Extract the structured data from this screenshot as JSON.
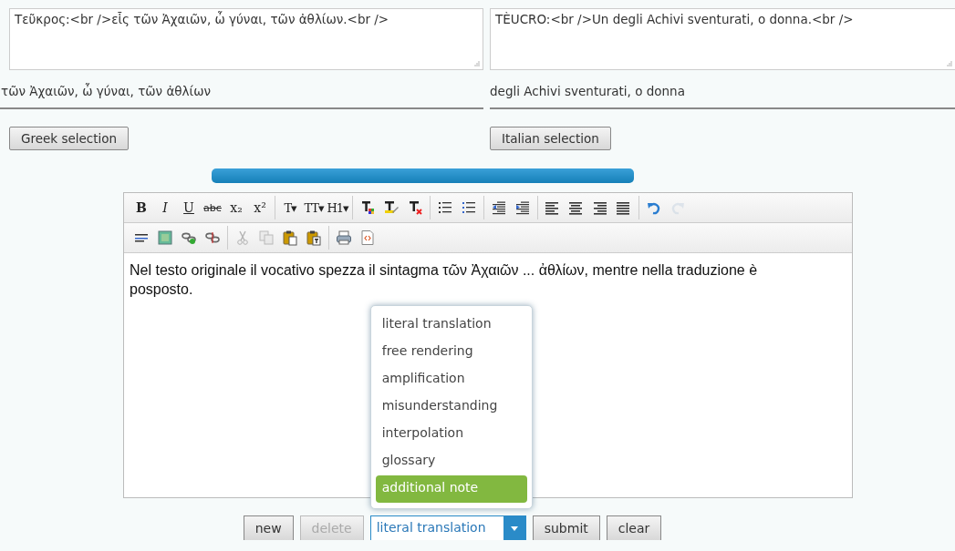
{
  "source_panel": {
    "text": "Τεῦκρος:<br />εἷς τῶν Ἀχαιῶν, ὦ γύναι, τῶν ἀθλίων.<br />",
    "selection": "τῶν Ἀχαιῶν, ὦ γύναι, τῶν ἀθλίων",
    "button": "Greek selection"
  },
  "target_panel": {
    "text": "TÈUCRO:<br />Un degli Achivi sventurati, o donna.<br />",
    "selection": "degli Achivi sventurati, o donna",
    "button": "Italian selection"
  },
  "progress": {
    "level": 1
  },
  "editor": {
    "toolbar_rows": [
      [
        [
          {
            "kind": "bold",
            "glyph": "B"
          },
          {
            "kind": "italic",
            "glyph": "I"
          },
          {
            "kind": "underline",
            "glyph": "U"
          },
          {
            "kind": "strike",
            "glyph": "abc"
          },
          {
            "kind": "sub",
            "glyph": "x₂"
          },
          {
            "kind": "sup",
            "glyph": "x²"
          }
        ],
        [
          {
            "kind": "font",
            "glyph": "T▾"
          },
          {
            "kind": "size",
            "glyph": "TT▾"
          },
          {
            "kind": "format",
            "glyph": "H1▾"
          }
        ],
        [
          {
            "kind": "text-color"
          },
          {
            "kind": "bg-color"
          },
          {
            "kind": "remove-format"
          }
        ],
        [
          {
            "kind": "bullet-list"
          },
          {
            "kind": "numbered-list"
          }
        ],
        [
          {
            "kind": "outdent"
          },
          {
            "kind": "indent"
          }
        ],
        [
          {
            "kind": "align-left"
          },
          {
            "kind": "align-center"
          },
          {
            "kind": "align-right"
          },
          {
            "kind": "justify"
          }
        ],
        [
          {
            "kind": "undo",
            "disabled": false
          },
          {
            "kind": "redo",
            "disabled": true
          }
        ]
      ],
      [
        [
          {
            "kind": "hr"
          },
          {
            "kind": "image"
          },
          {
            "kind": "link"
          },
          {
            "kind": "unlink"
          }
        ],
        [
          {
            "kind": "cut",
            "disabled": true
          },
          {
            "kind": "copy",
            "disabled": true
          },
          {
            "kind": "paste",
            "disabled": false
          },
          {
            "kind": "paste-text",
            "disabled": false
          }
        ],
        [
          {
            "kind": "print"
          },
          {
            "kind": "source"
          }
        ]
      ]
    ],
    "content": "Nel testo originale il vocativo spezza il sintagma τῶν Ἀχαιῶν ... ἀθλίων, mentre nella traduzione è posposto."
  },
  "dropdown": {
    "options": [
      {
        "label": "literal translation",
        "highlighted": false
      },
      {
        "label": "free rendering",
        "highlighted": false
      },
      {
        "label": "amplification",
        "highlighted": false
      },
      {
        "label": "misunderstanding",
        "highlighted": false
      },
      {
        "label": "interpolation",
        "highlighted": false
      },
      {
        "label": "glossary",
        "highlighted": false
      },
      {
        "label": "additional note",
        "highlighted": true
      }
    ]
  },
  "actions": [
    {
      "kind": "button",
      "label": "new",
      "disabled": false
    },
    {
      "kind": "button",
      "label": "delete",
      "disabled": true
    },
    {
      "kind": "select",
      "value": "literal translation"
    },
    {
      "kind": "button",
      "label": "submit",
      "disabled": false
    },
    {
      "kind": "button",
      "label": "clear",
      "disabled": false
    }
  ]
}
